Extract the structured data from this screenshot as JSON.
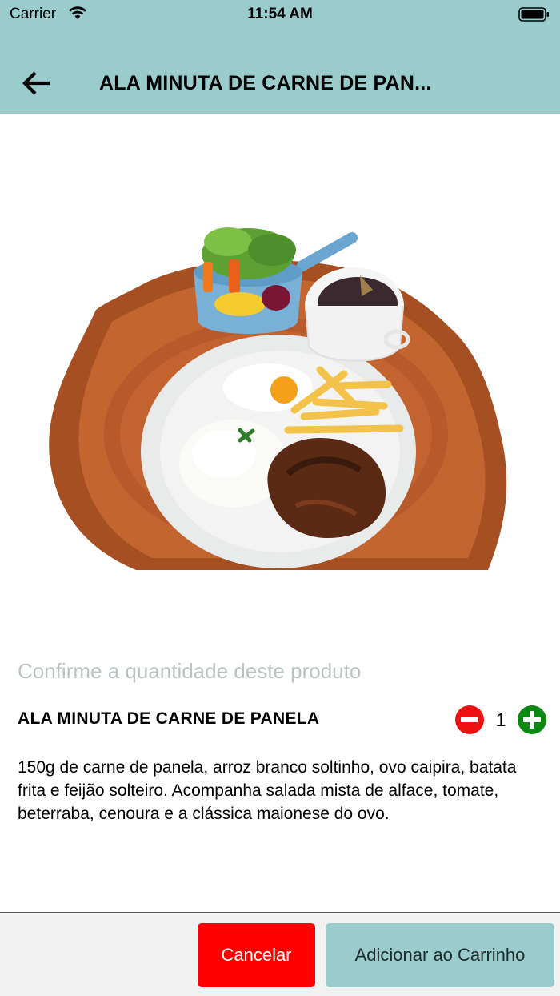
{
  "status_bar": {
    "carrier": "Carrier",
    "time": "11:54 AM",
    "icons": [
      "wifi-icon",
      "battery-icon"
    ]
  },
  "header": {
    "title": "ALA MINUTA DE CARNE DE PAN...",
    "back_icon": "arrow-left-icon",
    "background_color": "#99cccb"
  },
  "product": {
    "image_alt": "food-plate-image",
    "prompt": "Confirme a quantidade deste produto",
    "name": "ALA MINUTA DE CARNE DE PANELA",
    "quantity": "1",
    "description": "150g de carne de panela, arroz branco soltinho, ovo caipira, batata frita e feijão solteiro. Acompanha salada mista de alface, tomate, beterraba, cenoura e a clássica maionese do ovo."
  },
  "actions": {
    "cancel_label": "Cancelar",
    "add_label": "Adicionar ao Carrinho",
    "cancel_color": "#ff0000",
    "add_color": "#99cccb"
  },
  "colors": {
    "minus": "#ee1111",
    "plus": "#0a8a12"
  }
}
